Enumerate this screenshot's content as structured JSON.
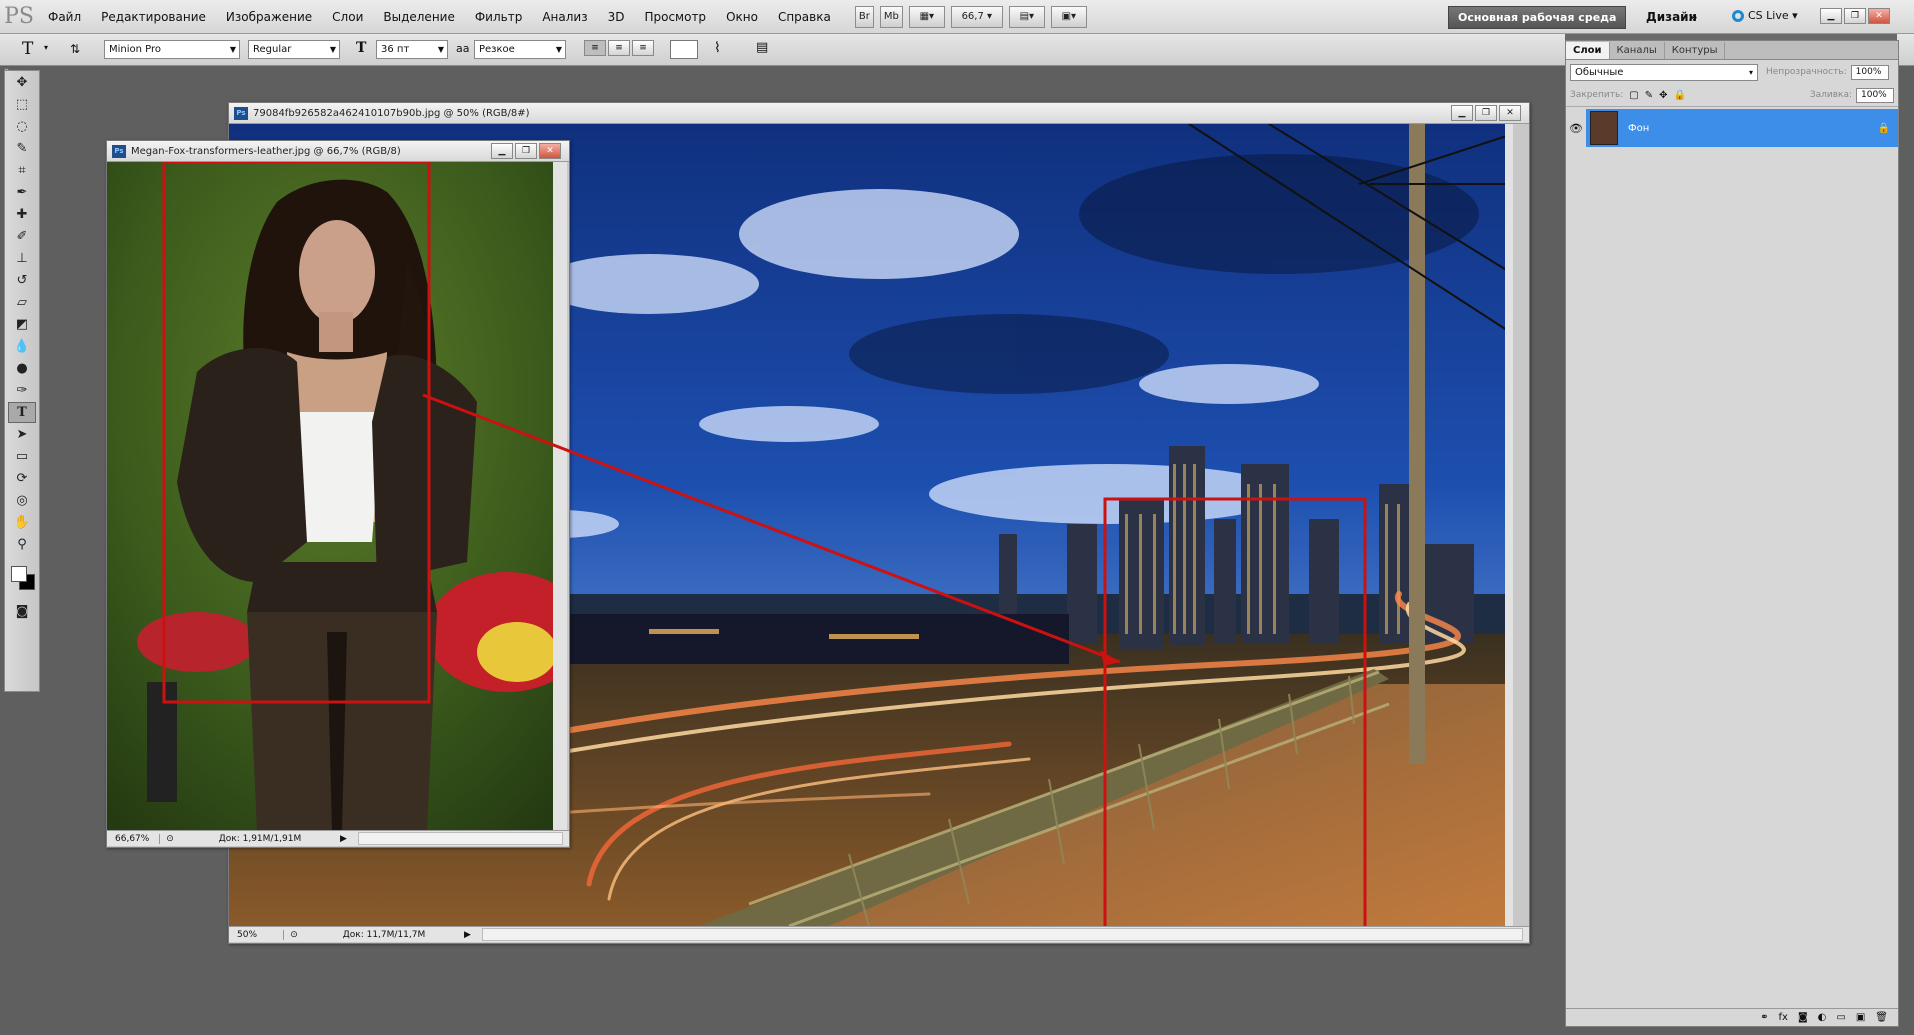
{
  "menubar": {
    "logo": "PS",
    "items": [
      "Файл",
      "Редактирование",
      "Изображение",
      "Слои",
      "Выделение",
      "Фильтр",
      "Анализ",
      "3D",
      "Просмотр",
      "Окно",
      "Справка"
    ],
    "br_label": "Br",
    "mb_label": "Mb",
    "zoom": "66,7",
    "workspace": "Основная рабочая среда",
    "design": "Дизайн",
    "more": "»",
    "cslive": "CS Live"
  },
  "options": {
    "font_family": "Minion Pro",
    "font_style": "Regular",
    "font_size": "36 пт",
    "antialias_icon": "aa",
    "antialias": "Резкое"
  },
  "doc_city": {
    "title": "79084fb926582a462410107b90b.jpg @ 50% (RGB/8#)",
    "zoom": "50%",
    "doc_size": "Док: 11,7M/11,7M"
  },
  "doc_megan": {
    "title": "Megan-Fox-transformers-leather.jpg @ 66,7% (RGB/8)",
    "zoom": "66,67%",
    "doc_size": "Док: 1,91M/1,91M"
  },
  "layers_panel": {
    "tabs": [
      "Слои",
      "Каналы",
      "Контуры"
    ],
    "blend_mode": "Обычные",
    "opacity_label": "Непрозрачность:",
    "opacity_value": "100%",
    "lock_label": "Закрепить:",
    "fill_label": "Заливка:",
    "fill_value": "100%",
    "layer_name": "Фон"
  },
  "colors": {
    "selection_red": "#cc1111",
    "layer_selected": "#3d8ee8"
  }
}
